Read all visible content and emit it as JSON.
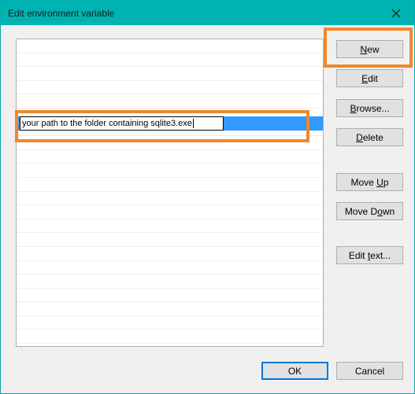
{
  "window": {
    "title": "Edit environment variable",
    "close_icon": "close-icon"
  },
  "list": {
    "editing_value": "your path to the folder containing sqlite3.exe",
    "selected_row_color": "#3399ff"
  },
  "buttons": {
    "new": {
      "before": "",
      "mnemonic": "N",
      "after": "ew"
    },
    "edit": {
      "before": "",
      "mnemonic": "E",
      "after": "dit"
    },
    "browse": {
      "before": "",
      "mnemonic": "B",
      "after": "rowse..."
    },
    "delete": {
      "before": "",
      "mnemonic": "D",
      "after": "elete"
    },
    "move_up": {
      "before": "Move ",
      "mnemonic": "U",
      "after": "p"
    },
    "move_down": {
      "before": "Move D",
      "mnemonic": "o",
      "after": "wn"
    },
    "edit_text": {
      "before": "Edit ",
      "mnemonic": "t",
      "after": "ext..."
    },
    "ok": "OK",
    "cancel": "Cancel"
  },
  "colors": {
    "titlebar": "#00b3b3",
    "annotation_highlight": "#f0882d",
    "selection": "#3399ff"
  }
}
